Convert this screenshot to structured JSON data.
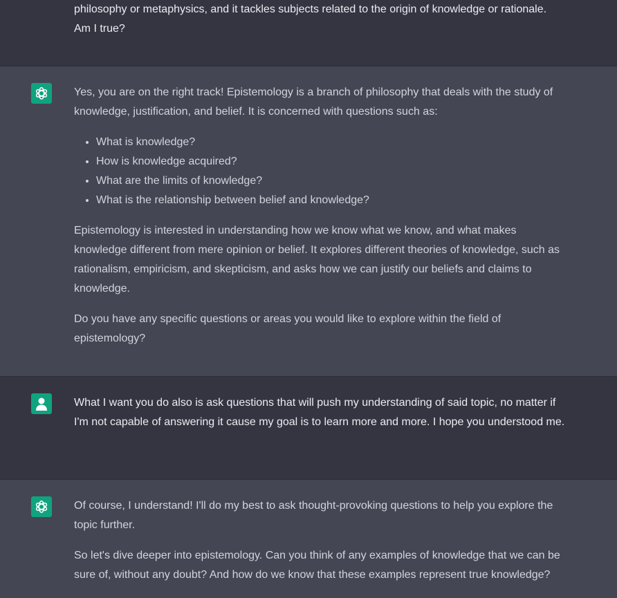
{
  "messages": [
    {
      "role": "user",
      "paragraphs": [
        "philosophy or metaphysics, and it tackles subjects related to the origin of knowledge or rationale.",
        "Am I true?"
      ]
    },
    {
      "role": "assistant",
      "intro": "Yes, you are on the right track! Epistemology is a branch of philosophy that deals with the study of knowledge, justification, and belief. It is concerned with questions such as:",
      "bullets": [
        "What is knowledge?",
        "How is knowledge acquired?",
        "What are the limits of knowledge?",
        "What is the relationship between belief and knowledge?"
      ],
      "para2": "Epistemology is interested in understanding how we know what we know, and what makes knowledge different from mere opinion or belief. It explores different theories of knowledge, such as rationalism, empiricism, and skepticism, and asks how we can justify our beliefs and claims to knowledge.",
      "para3": "Do you have any specific questions or areas you would like to explore within the field of epistemology?"
    },
    {
      "role": "user",
      "text": "What I want you do also is ask questions that will push my understanding of said topic, no matter if I'm not capable of answering it cause my goal is to learn more and more. I hope you understood me."
    },
    {
      "role": "assistant",
      "para1": "Of course, I understand! I'll do my best to ask thought-provoking questions to help you explore the topic further.",
      "para2": "So let's dive deeper into epistemology. Can you think of any examples of knowledge that we can be sure of, without any doubt? And how do we know that these examples represent true knowledge?"
    }
  ],
  "colors": {
    "user_bg": "#343541",
    "assistant_bg": "#444654",
    "avatar_bg": "#10a37f"
  },
  "icons": {
    "assistant_avatar": "openai-logo-icon",
    "user_avatar": "user-silhouette-icon"
  }
}
